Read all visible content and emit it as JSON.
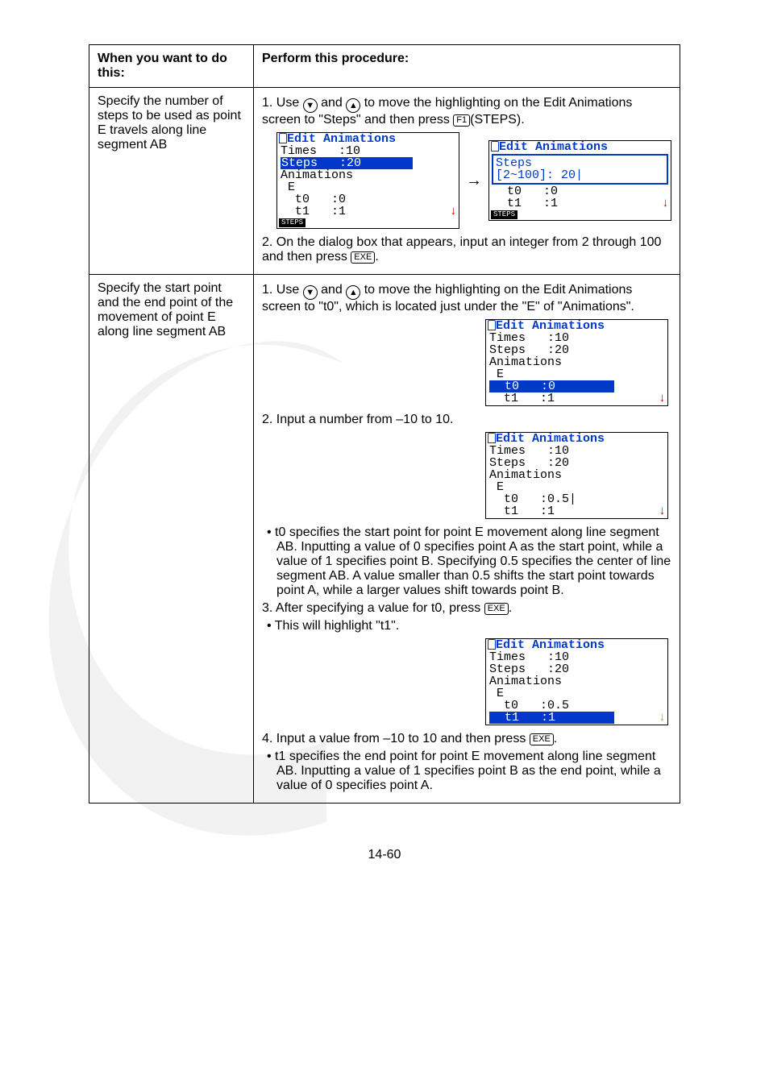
{
  "table": {
    "header": {
      "col1": "When you want to do this:",
      "col2": "Perform this procedure:"
    },
    "row1": {
      "task": "Specify the number of steps to be used as point E travels along line segment AB",
      "step1_a": "1. Use ",
      "step1_b": " and ",
      "step1_c": " to move the highlighting on the Edit Animations screen to \"Steps\" and then press ",
      "step1_d": "(STEPS).",
      "key_f1": "F1",
      "step2_a": "2. On the dialog box that appears, input an integer from 2 through 100 and then press ",
      "step2_b": ".",
      "key_exe": "EXE",
      "lcd1": {
        "title": "Edit Animations",
        "l1": "Times   :10",
        "l2a": "Steps",
        "l2b": ":20",
        "l3": "Animations",
        "l4": " E",
        "l5": "  t0   :0",
        "l6": "  t1   :1",
        "fkey": "STEPS"
      },
      "lcd2": {
        "title": "Edit Animations",
        "dlg_title": "Steps",
        "dlg_body": "[2~100]: 20|",
        "l5": "  t0   :0",
        "l6": "  t1   :1",
        "fkey": "STEPS"
      }
    },
    "row2": {
      "task": "Specify the start point and the end point of the movement of point E along line segment AB",
      "step1_a": "1. Use ",
      "step1_b": " and ",
      "step1_c": " to move the highlighting on the Edit Animations screen to \"t0\", which is located just under the \"E\" of \"Animations\".",
      "lcd1": {
        "title": "Edit Animations",
        "l1": "Times   :10",
        "l2": "Steps   :20",
        "l3": "Animations",
        "l4": " E",
        "l5a": "  t0",
        "l5b": ":0",
        "l6": "  t1   :1"
      },
      "step2": "2. Input a number from –10 to 10.",
      "lcd2": {
        "title": "Edit Animations",
        "l1": "Times   :10",
        "l2": "Steps   :20",
        "l3": "Animations",
        "l4": " E",
        "l5": "  t0   :0.5|",
        "l6": "  t1   :1"
      },
      "bullet1": "• t0 specifies the start point for point E movement along line segment AB. Inputting a value of 0 specifies point A as the start point, while a value of 1 specifies point B. Specifying 0.5 specifies the center of line segment AB. A value smaller than 0.5 shifts the start point towards point A, while a larger values shift towards point B.",
      "step3_a": "3. After specifying a value for t0, press ",
      "step3_b": ".",
      "bullet2": "• This will highlight \"t1\".",
      "lcd3": {
        "title": "Edit Animations",
        "l1": "Times   :10",
        "l2": "Steps   :20",
        "l3": "Animations",
        "l4": " E",
        "l5": "  t0   :0.5",
        "l6a": "  t1",
        "l6b": ":1"
      },
      "step4_a": "4. Input a value from –10 to 10 and then press ",
      "step4_b": ".",
      "bullet3": "• t1 specifies the end point for point E movement along line segment AB. Inputting a value of 1 specifies point B as the end point, while a value of 0 specifies point A."
    }
  },
  "pagenum": "14-60"
}
